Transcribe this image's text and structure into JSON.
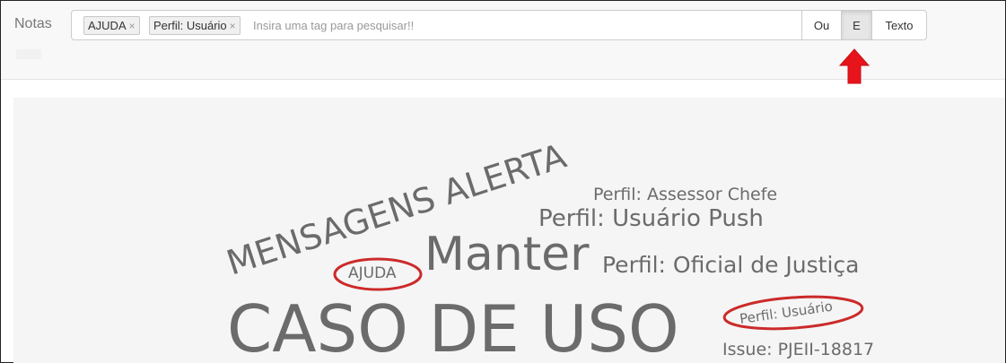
{
  "header": {
    "label": "Notas",
    "tags": [
      {
        "label": "AJUDA",
        "remove": "×"
      },
      {
        "label": "Perfil: Usuário",
        "remove": "×"
      }
    ],
    "search": {
      "placeholder": "Insira uma tag para pesquisar!!",
      "value": ""
    },
    "buttons": {
      "or": "Ou",
      "and": "E",
      "text": "Texto"
    },
    "active_button": "E"
  },
  "annotation_colors": {
    "arrow": "#e8141b",
    "ellipse": "#cc2a2a"
  },
  "word_cloud": {
    "words": [
      {
        "text": "MENSAGENS ALERTA"
      },
      {
        "text": "Perfil: Assessor Chefe"
      },
      {
        "text": "Perfil: Usuário Push"
      },
      {
        "text": "Manter"
      },
      {
        "text": "Perfil: Oficial de Justiça"
      },
      {
        "text": "AJUDA",
        "highlighted": true
      },
      {
        "text": "CASO DE USO"
      },
      {
        "text": "Perfil: Usuário",
        "highlighted": true
      },
      {
        "text": "Issue: PJEII-18817"
      }
    ]
  }
}
